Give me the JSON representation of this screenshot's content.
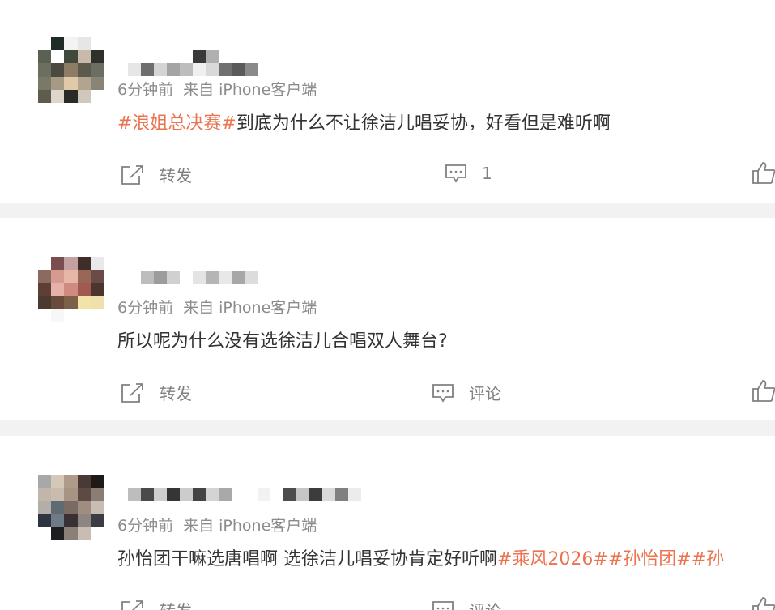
{
  "posts": [
    {
      "meta": {
        "time": "6分钟前",
        "source": "来自 iPhone客户端"
      },
      "content": {
        "tag": "#浪姐总决赛#",
        "text": "到底为什么不让徐洁儿唱妥协，好看但是难听啊"
      },
      "actions": {
        "repost": "转发",
        "comment": "1"
      }
    },
    {
      "meta": {
        "time": "6分钟前",
        "source": "来自 iPhone客户端"
      },
      "content": {
        "text": "所以呢为什么没有选徐洁儿合唱双人舞台?"
      },
      "actions": {
        "repost": "转发",
        "comment": "评论"
      }
    },
    {
      "meta": {
        "time": "6分钟前",
        "source": "来自 iPhone客户端"
      },
      "content": {
        "text": "孙怡团干嘛选唐唱啊 选徐洁儿唱妥协肯定好听啊",
        "tags": "#乘风2026##孙怡团##孙"
      },
      "actions": {
        "repost": "转发",
        "comment": "评论"
      }
    }
  ],
  "icons": [
    "repost-icon",
    "comment-icon",
    "like-icon"
  ],
  "colors": {
    "tag": "#eb7350",
    "meta": "#8c8c8c",
    "text": "#333333",
    "action": "#808080"
  }
}
